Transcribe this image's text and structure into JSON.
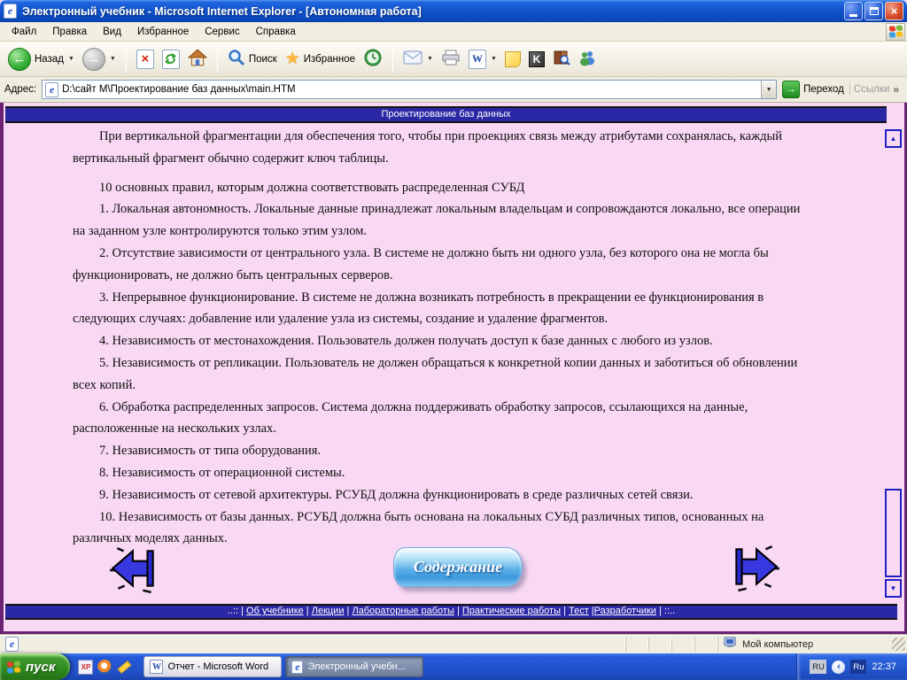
{
  "window": {
    "title": "Электронный учебник - Microsoft Internet Explorer - [Автономная работа]",
    "menu": [
      "Файл",
      "Правка",
      "Вид",
      "Избранное",
      "Сервис",
      "Справка"
    ],
    "toolbar": {
      "back_label": "Назад",
      "search_label": "Поиск",
      "favorites_label": "Избранное"
    },
    "address": {
      "label": "Адрес:",
      "value": "D:\\сайт М\\Проектирование баз данных\\main.HTM",
      "go_label": "Переход",
      "links_label": "Ссылки"
    }
  },
  "page": {
    "banner_title": "Проектирование баз данных",
    "paragraphs": [
      "При вертикальной фрагментации для обеспечения того, чтобы при проекциях связь между атрибутами сохранялась, каждый вертикальный фрагмент обычно содержит ключ таблицы.",
      "10 основных правил, которым должна соответствовать распределенная СУБД",
      "1. Локальная автономность. Локальные данные принадлежат локальным владельцам и сопровождаются локально, все операции на заданном узле контролируются только этим узлом.",
      "2. Отсутствие зависимости от центрального узла. В системе не должно быть ни одного узла, без которого она не могла бы функционировать, не должно быть центральных серверов.",
      "3. Непрерывное функционирование. В системе не должна возникать потребность в прекращении ее функционирования в следующих случаях: добавление или удаление узла из системы, создание и удаление фрагментов.",
      "4. Независимость от местонахождения. Пользователь должен получать доступ к базе данных с любого из узлов.",
      "5. Независимость от репликации. Пользователь не должен обращаться к конкретной копии данных и заботиться об обновлении всех копий.",
      "6. Обработка распределенных запросов. Система должна поддерживать обработку запросов, ссылающихся на данные, расположенные на нескольких узлах.",
      "7. Независимость от типа оборудования.",
      "8. Независимость от операционной системы.",
      "9. Независимость от сетевой архитектуры. РСУБД должна функционировать в среде различных сетей связи.",
      "10. Независимость от базы данных. РСУБД должна быть основана на локальных СУБД различных типов, основанных на различных моделях данных."
    ],
    "contents_button_label": "Содержание",
    "footer": {
      "prefix": "..:: | ",
      "links": [
        "Об учебнике",
        "Лекции",
        "Лабораторные работы",
        "Практические работы",
        "Тест",
        "Разработчики"
      ],
      "sep": " | ",
      "sep_tight": " |",
      "suffix": " | ::.."
    }
  },
  "status": {
    "my_computer": "Мой компьютер"
  },
  "taskbar": {
    "start_label": "пуск",
    "tasks": [
      {
        "label": "Отчет - Microsoft Word"
      },
      {
        "label": "Электронный учебн..."
      }
    ],
    "lang_outer": "RU",
    "lang_inner": "Ru",
    "clock": "22:37"
  },
  "icons": {
    "ie_letter": "e",
    "back_arrow": "←",
    "forward_arrow": "→",
    "stop_x": "×",
    "word_letter": "W",
    "kaspersky_letter": "K",
    "star": "★",
    "caret": "▼",
    "go_arrow": "→",
    "links_more": "»",
    "scroll_up": "▲",
    "scroll_down": "▼",
    "close_x": "×",
    "xp_label": "XP",
    "tray_chevron": "‹"
  },
  "colors": {
    "banner_blue": "#2B28A5",
    "page_pink": "#F9D8F3",
    "frame_purple": "#6B2275",
    "taskbar_blue": "#2150C8",
    "start_green": "#2E8A20"
  }
}
